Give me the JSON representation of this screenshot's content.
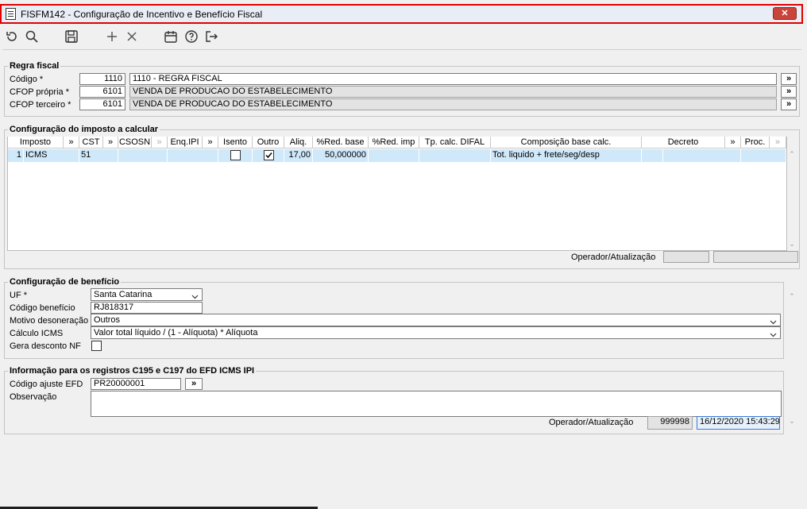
{
  "window": {
    "title": "FISFM142 - Configuração de Incentivo e Benefício Fiscal",
    "close_label": "✕"
  },
  "toolbar": {
    "icons": [
      "refresh-icon",
      "search-icon",
      "save-icon",
      "add-icon",
      "delete-icon",
      "calendar-icon",
      "help-icon",
      "exit-icon"
    ]
  },
  "regra_fiscal": {
    "legend": "Regra fiscal",
    "codigo_label": "Código *",
    "codigo_value": "1110",
    "codigo_desc": "1110 - REGRA FISCAL",
    "cfop_propria_label": "CFOP própria *",
    "cfop_propria_value": "6101",
    "cfop_propria_desc": "VENDA DE PRODUCAO DO ESTABELECIMENTO",
    "cfop_terceiro_label": "CFOP terceiro *",
    "cfop_terceiro_value": "6101",
    "cfop_terceiro_desc": "VENDA DE PRODUCAO DO ESTABELECIMENTO",
    "lookup_label": "»"
  },
  "imposto": {
    "legend": "Configuração do imposto a calcular",
    "headers": {
      "imposto": "Imposto",
      "cst": "CST",
      "csosn": "CSOSN",
      "enq_ipi": "Enq.IPI",
      "isento": "Isento",
      "outro": "Outro",
      "aliq": "Aliq.",
      "red_base": "%Red. base",
      "red_imp": "%Red. imp",
      "tp_calc_difal": "Tp. calc. DIFAL",
      "composicao": "Composição base calc.",
      "decreto": "Decreto",
      "proc": "Proc.",
      "lookup": "»"
    },
    "row": {
      "num": "1",
      "imposto": "ICMS",
      "cst": "51",
      "aliq": "17,00",
      "red_base": "50,000000",
      "composicao": "Tot. liquido + frete/seg/desp",
      "isento": false,
      "outro": true
    },
    "operador_label": "Operador/Atualização"
  },
  "beneficio": {
    "legend": "Configuração de benefício",
    "uf_label": "UF *",
    "uf_value": "Santa Catarina",
    "codigo_label": "Código benefício",
    "codigo_value": "RJ818317",
    "motivo_label": "Motivo desoneração",
    "motivo_value": "Outros",
    "calculo_label": "Cálculo ICMS",
    "calculo_value": "Valor total líquido / (1 - Alíquota) * Alíquota",
    "gera_label": "Gera desconto NF",
    "gera_value": false
  },
  "efd": {
    "legend": "Informação para os registros C195 e C197 do EFD ICMS IPI",
    "codigo_label": "Código ajuste EFD",
    "codigo_value": "PR20000001",
    "obs_label": "Observação",
    "obs_value": "",
    "operador_label": "Operador/Atualização",
    "operador_value": "999998",
    "atualizacao_value": "16/12/2020 15:43:29"
  }
}
